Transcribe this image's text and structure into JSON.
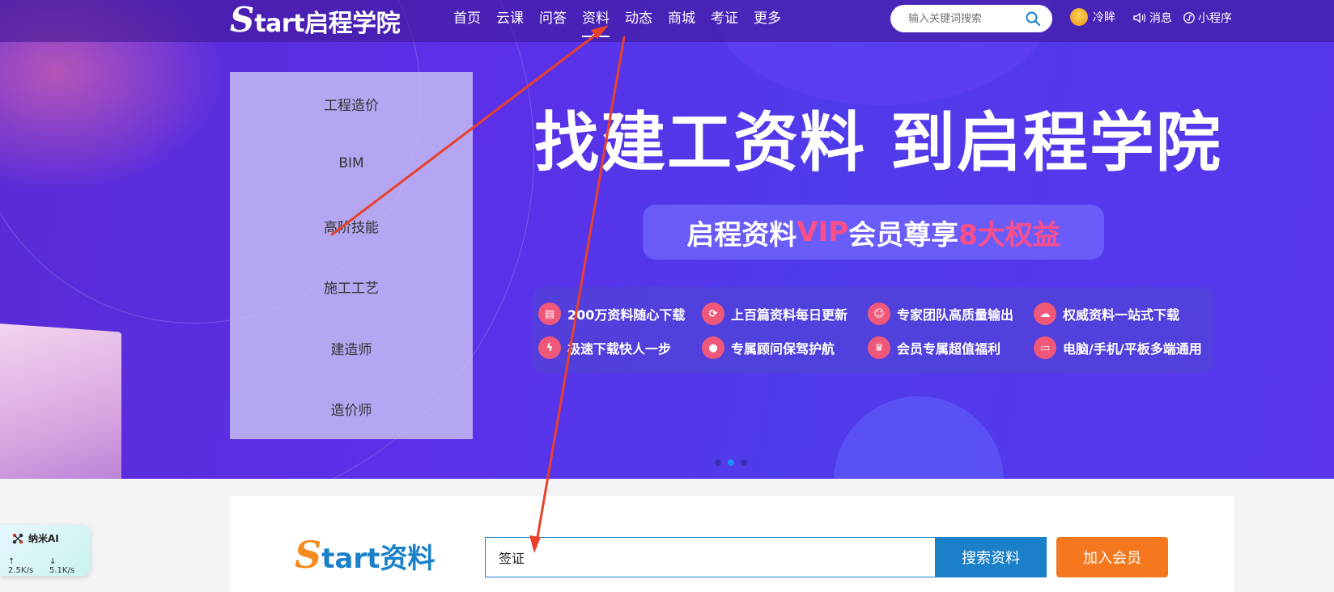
{
  "nav": {
    "logo_mark": "S",
    "logo_text": "tart启程学院",
    "items": [
      "首页",
      "云课",
      "问答",
      "资料",
      "动态",
      "商城",
      "考证",
      "更多"
    ],
    "active_index": 3,
    "search_placeholder": "输入关键词搜索",
    "user_name": "冷眸",
    "messages_label": "消息",
    "miniprogram_label": "小程序"
  },
  "categories": [
    "工程造价",
    "BIM",
    "高阶技能",
    "施工工艺",
    "建造师",
    "造价师"
  ],
  "hero": {
    "title": "找建工资料 到启程学院",
    "vip_part1": "启程资料",
    "vip_part2": "VIP",
    "vip_part3": "会员尊享",
    "vip_part4": "8大权益"
  },
  "benefits": [
    "200万资料随心下载",
    "上百篇资料每日更新",
    "专家团队高质量输出",
    "权威资料一站式下载",
    "极速下载快人一步",
    "专属顾问保驾护航",
    "会员专属超值福利",
    "电脑/手机/平板多端通用"
  ],
  "carousel": {
    "count": 3,
    "active": 1
  },
  "lower": {
    "logo_mark": "S",
    "logo_text": "tart资料",
    "search_value": "签证",
    "search_button": "搜索资料",
    "join_button": "加入会员"
  },
  "widget": {
    "name": "纳米AI",
    "upload": "↑ 2.5K/s",
    "download": "↓ 5.1K/s"
  },
  "colors": {
    "accent_blue": "#1a80c8",
    "accent_orange": "#f5781e",
    "pink": "#ff4f8a",
    "annotation_red": "#e8402a"
  }
}
